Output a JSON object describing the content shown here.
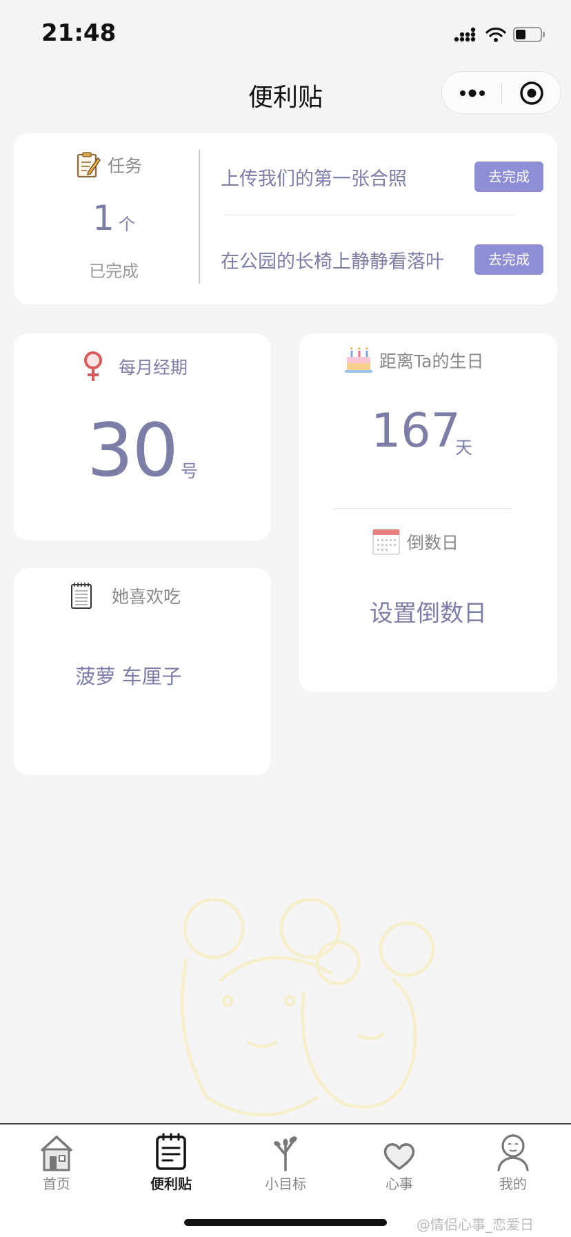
{
  "status_bar": {
    "time": "21:48"
  },
  "header": {
    "title": "便利贴"
  },
  "tasks": {
    "heading": "任务",
    "count": "1",
    "count_unit": "个",
    "done_label": "已完成",
    "items": [
      {
        "text": "上传我们的第一张合照",
        "button": "去完成"
      },
      {
        "text": "在公园的长椅上静静看落叶",
        "button": "去完成"
      }
    ]
  },
  "period": {
    "heading": "每月经期",
    "day": "30",
    "unit": "号"
  },
  "birthday": {
    "heading": "距离Ta的生日",
    "days": "167",
    "unit": "天"
  },
  "countdown": {
    "heading": "倒数日",
    "action": "设置倒数日"
  },
  "likes": {
    "heading": "她喜欢吃",
    "text": "菠萝 车厘子"
  },
  "tab_bar": {
    "active": "便利贴",
    "items": [
      {
        "label": "首页",
        "icon": "house-icon"
      },
      {
        "label": "便利贴",
        "icon": "notepad-icon"
      },
      {
        "label": "小目标",
        "icon": "sapling-icon"
      },
      {
        "label": "心事",
        "icon": "heart-icon"
      },
      {
        "label": "我的",
        "icon": "person-icon"
      }
    ]
  },
  "credit": "@情侣心事_恋爱日",
  "colors": {
    "accent": "#7c7ea8",
    "button": "#8d8ed6",
    "background": "#f5f5f5"
  }
}
